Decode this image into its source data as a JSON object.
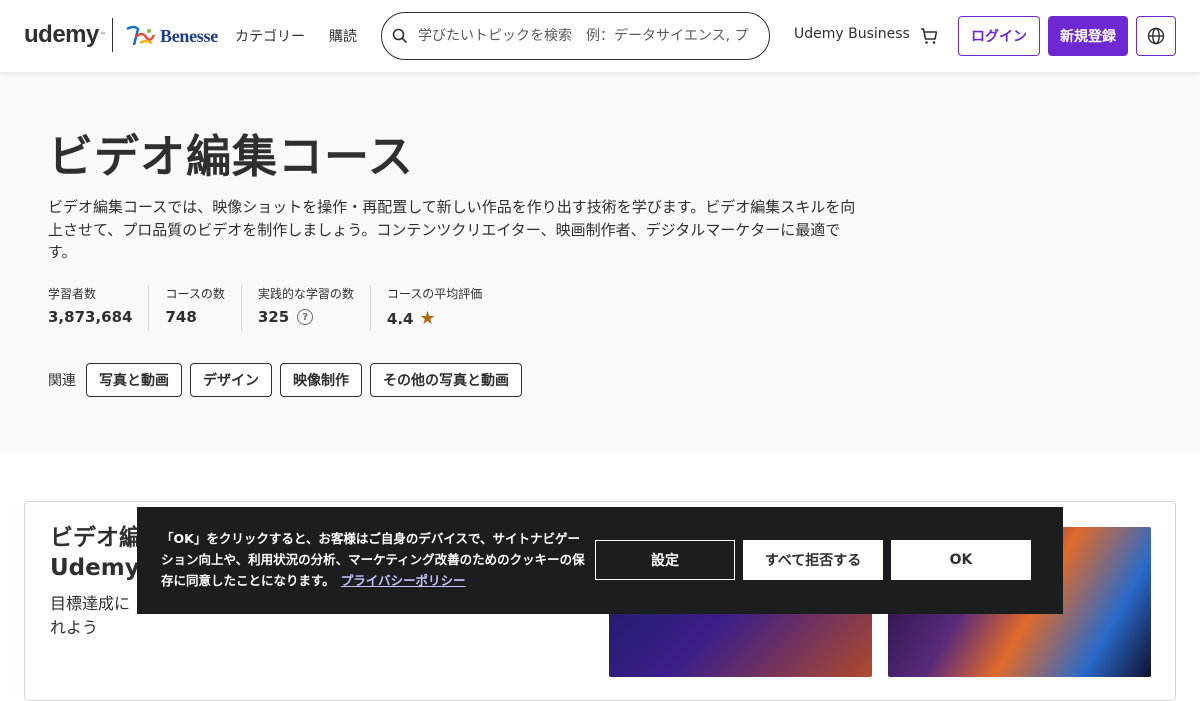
{
  "header": {
    "logo_text": "udemy",
    "partner_logo_text": "Benesse",
    "categories_label": "カテゴリー",
    "subscription_label": "購読",
    "search_placeholder": "学びたいトピックを検索　例：データサイエンス, プ",
    "business_label": "Udemy Business",
    "login_label": "ログイン",
    "signup_label": "新規登録",
    "icons": [
      "search-icon",
      "cart-icon",
      "globe-icon"
    ],
    "accent_color": "#6d28d2"
  },
  "hero": {
    "title": "ビデオ編集コース",
    "description": "ビデオ編集コースでは、映像ショットを操作・再配置して新しい作品を作り出す技術を学びます。ビデオ編集スキルを向上させて、プロ品質のビデオを制作しましょう。コンテンツクリエイター、映画制作者、デジタルマーケターに最適です。",
    "stats": [
      {
        "label": "学習者数",
        "value": "3,873,684"
      },
      {
        "label": "コースの数",
        "value": "748"
      },
      {
        "label": "実践的な学習の数",
        "value": "325"
      },
      {
        "label": "コースの平均評価",
        "value": "4.4"
      }
    ],
    "related_label": "関連",
    "related_topics": [
      "写真と動画",
      "デザイン",
      "映像制作",
      "その他の写真と動画"
    ]
  },
  "card": {
    "title_line1": "ビデオ編",
    "title_line2": "Udemyに",
    "sub_line1": "目標達成に",
    "sub_line2": "れよう"
  },
  "cookie_banner": {
    "text": "「OK」をクリックすると、お客様はご自身のデバイスで、サイトナビゲーション向上や、利用状況の分析、マーケティング改善のためのクッキーの保存に同意したことになります。",
    "privacy_link": "プライバシーポリシー",
    "settings_label": "設定",
    "reject_label": "すべて拒否する",
    "ok_label": "OK"
  }
}
